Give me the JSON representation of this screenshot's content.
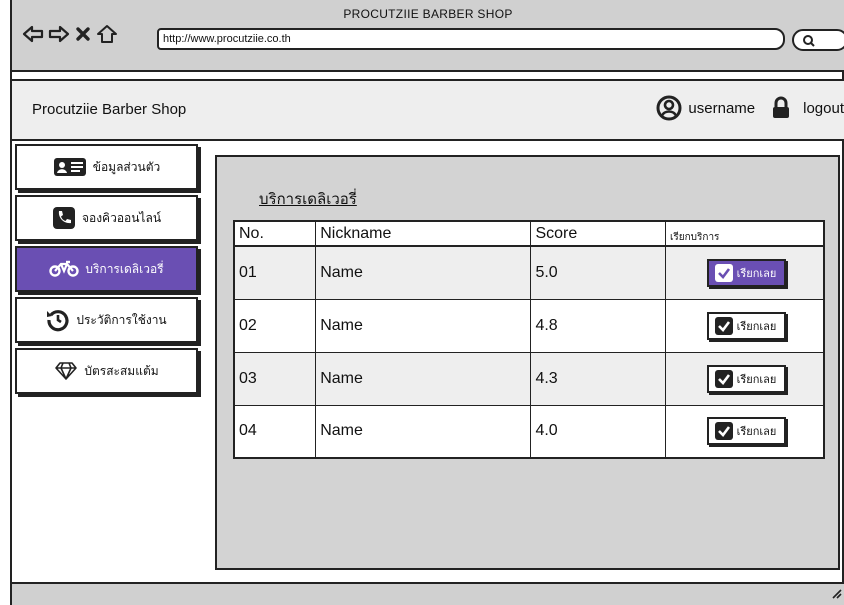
{
  "browser": {
    "window_title": "PROCUTZIIE BARBER SHOP",
    "url": "http://www.procutziie.co.th"
  },
  "header": {
    "brand": "Procutziie Barber Shop",
    "username": "username",
    "logout": "logout"
  },
  "sidebar": {
    "items": [
      {
        "label": "ข้อมูลส่วนตัว",
        "icon": "id-card-icon"
      },
      {
        "label": "จองคิวออนไลน์",
        "icon": "phone-icon"
      },
      {
        "label": "บริการเดลิเวอรี่",
        "icon": "motorcycle-icon"
      },
      {
        "label": "ประวัติการใช้งาน",
        "icon": "history-icon"
      },
      {
        "label": "บัตรสะสมแต้ม",
        "icon": "diamond-icon"
      }
    ],
    "active_index": 2
  },
  "main": {
    "title": "บริการเดลิเวอรี่",
    "columns": [
      "No.",
      "Nickname",
      "Score",
      "เรียกบริการ"
    ],
    "rows": [
      {
        "no": "01",
        "nickname": "Name",
        "score": "5.0",
        "call": "เรียกเลย"
      },
      {
        "no": "02",
        "nickname": "Name",
        "score": "4.8",
        "call": "เรียกเลย"
      },
      {
        "no": "03",
        "nickname": "Name",
        "score": "4.3",
        "call": "เรียกเลย"
      },
      {
        "no": "04",
        "nickname": "Name",
        "score": "4.0",
        "call": "เรียกเลย"
      }
    ]
  },
  "colors": {
    "accent": "#6a4fb3",
    "panel": "#d3d3d3",
    "header": "#eeeeee"
  }
}
